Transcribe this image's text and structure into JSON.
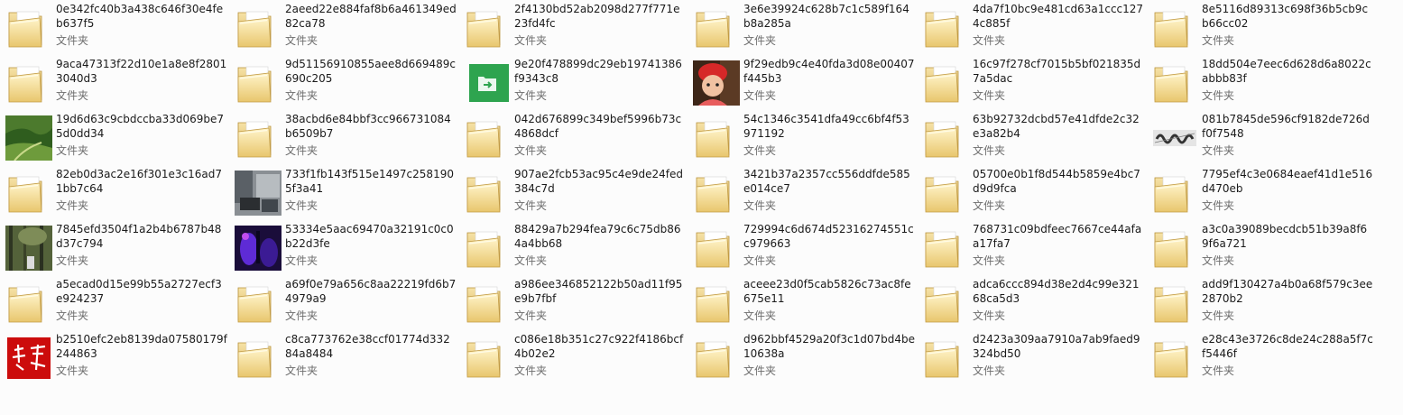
{
  "type_label": "文件夹",
  "items": [
    {
      "name": "0e342fc40b3a438c646f30e4feb637f5",
      "icon": "folder-icon"
    },
    {
      "name": "2aeed22e884faf8b6a461349ed82ca78",
      "icon": "folder-icon"
    },
    {
      "name": "2f4130bd52ab2098d277f771e23fd4fc",
      "icon": "folder-icon"
    },
    {
      "name": "3e6e39924c628b7c1c589f164b8a285a",
      "icon": "folder-icon"
    },
    {
      "name": "4da7f10bc9e481cd63a1ccc1274c885f",
      "icon": "folder-icon"
    },
    {
      "name": "8e5116d89313c698f36b5cb9cb66cc02",
      "icon": "folder-icon"
    },
    {
      "name": "9aca47313f22d10e1a8e8f28013040d3",
      "icon": "folder-icon"
    },
    {
      "name": "9d51156910855aee8d669489c690c205",
      "icon": "folder-icon"
    },
    {
      "name": "9e20f478899dc29eb19741386f9343c8",
      "icon": "green-app-icon"
    },
    {
      "name": "9f29edb9c4e40fda3d08e00407f445b3",
      "icon": "photo-child-icon"
    },
    {
      "name": "16c97f278cf7015b5bf021835d7a5dac",
      "icon": "folder-icon"
    },
    {
      "name": "18dd504e7eec6d628d6a8022cabbb83f",
      "icon": "folder-icon"
    },
    {
      "name": "19d6d63c9cbdccba33d069be75d0dd34",
      "icon": "photo-landscape-icon"
    },
    {
      "name": "38acbd6e84bbf3cc966731084b6509b7",
      "icon": "folder-icon"
    },
    {
      "name": "042d676899c349bef5996b73c4868dcf",
      "icon": "folder-icon"
    },
    {
      "name": "54c1346c3541dfa49cc6bf4f53971192",
      "icon": "folder-icon"
    },
    {
      "name": "63b92732dcbd57e41dfde2c32e3a82b4",
      "icon": "folder-icon"
    },
    {
      "name": "081b7845de596cf9182de726df0f7548",
      "icon": "captcha-image-icon"
    },
    {
      "name": "82eb0d3ac2e16f301e3c16ad71bb7c64",
      "icon": "folder-icon"
    },
    {
      "name": "733f1fb143f515e1497c2581905f3a41",
      "icon": "photo-street-icon"
    },
    {
      "name": "907ae2fcb53ac95c4e9de24fed384c7d",
      "icon": "folder-icon"
    },
    {
      "name": "3421b37a2357cc556ddfde585e014ce7",
      "icon": "folder-icon"
    },
    {
      "name": "05700e0b1f8d544b5859e4bc7d9d9fca",
      "icon": "folder-icon"
    },
    {
      "name": "7795ef4c3e0684eaef41d1e516d470eb",
      "icon": "folder-icon"
    },
    {
      "name": "7845efd3504f1a2b4b6787b48d37c794",
      "icon": "photo-forest-icon"
    },
    {
      "name": "53334e5aac69470a32191c0c0b22d3fe",
      "icon": "photo-purple-icon"
    },
    {
      "name": "88429a7b294fea79c6c75db864a4bb68",
      "icon": "folder-icon"
    },
    {
      "name": "729994c6d674d52316274551cc979663",
      "icon": "folder-icon"
    },
    {
      "name": "768731c09bdfeec7667ce44afaa17fa7",
      "icon": "folder-icon"
    },
    {
      "name": "a3c0a39089becdcb51b39a8f69f6a721",
      "icon": "folder-icon"
    },
    {
      "name": "a5ecad0d15e99b55a2727ecf3e924237",
      "icon": "folder-icon"
    },
    {
      "name": "a69f0e79a656c8aa22219fd6b74979a9",
      "icon": "folder-icon"
    },
    {
      "name": "a986ee346852122b50ad11f95e9b7fbf",
      "icon": "folder-icon"
    },
    {
      "name": "aceee23d0f5cab5826c73ac8fe675e11",
      "icon": "folder-icon"
    },
    {
      "name": "adca6ccc894d38e2d4c99e32168ca5d3",
      "icon": "folder-icon"
    },
    {
      "name": "add9f130427a4b0a68f579c3ee2870b2",
      "icon": "folder-icon"
    },
    {
      "name": "b2510efc2eb8139da07580179f244863",
      "icon": "red-calligraphy-icon"
    },
    {
      "name": "c8ca773762e38ccf01774d33284a8484",
      "icon": "folder-icon"
    },
    {
      "name": "c086e18b351c27c922f4186bcf4b02e2",
      "icon": "folder-icon"
    },
    {
      "name": "d962bbf4529a20f3c1d07bd4be10638a",
      "icon": "folder-icon"
    },
    {
      "name": "d2423a309aa7910a7ab9faed9324bd50",
      "icon": "folder-icon"
    },
    {
      "name": "e28c43e3726c8de24c288a5f7cf5446f",
      "icon": "folder-icon"
    }
  ]
}
